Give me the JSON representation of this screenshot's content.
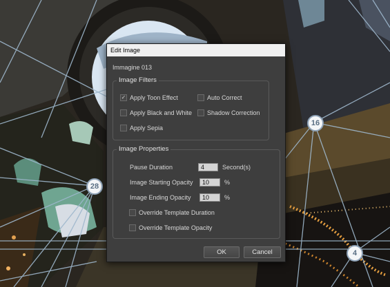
{
  "dialog": {
    "title": "Edit Image",
    "image_name": "Immagine 013",
    "filters": {
      "group_title": "Image Filters",
      "options": [
        {
          "label": "Apply Toon Effect",
          "checked": true
        },
        {
          "label": "Apply Black and White",
          "checked": false
        },
        {
          "label": "Apply Sepia",
          "checked": false
        },
        {
          "label": "Auto Correct",
          "checked": false
        },
        {
          "label": "Shadow Correction",
          "checked": false
        }
      ]
    },
    "properties": {
      "group_title": "Image Properties",
      "pause_duration_label": "Pause Duration",
      "pause_duration_value": "4",
      "pause_duration_unit": "Second(s)",
      "start_opacity_label": "Image Starting Opacity",
      "start_opacity_value": "10",
      "start_opacity_unit": "%",
      "end_opacity_label": "Image Ending Opacity",
      "end_opacity_value": "10",
      "end_opacity_unit": "%",
      "override_duration_label": "Override Template Duration",
      "override_duration_checked": false,
      "override_opacity_label": "Override Template Opacity",
      "override_opacity_checked": false
    },
    "ok_label": "OK",
    "cancel_label": "Cancel"
  },
  "background": {
    "nodes": [
      "16",
      "28",
      "4"
    ]
  }
}
